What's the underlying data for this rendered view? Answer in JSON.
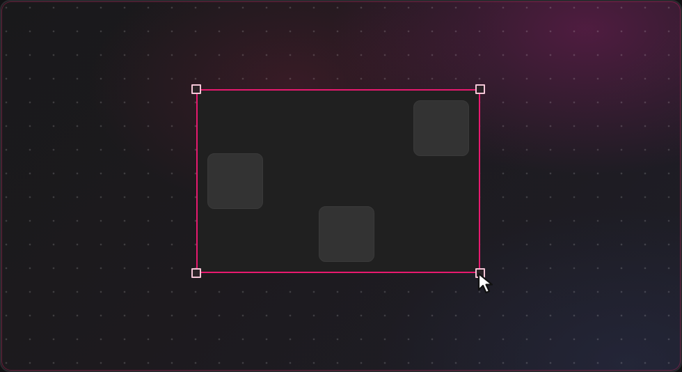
{
  "canvas": {
    "background": "dot-grid-dark",
    "accent_color": "#e8196f"
  },
  "selection": {
    "frame_fill": "#202020",
    "frame_stroke": "#e8196f",
    "handle_fill": "#f5c7d8",
    "handles": [
      "top-left",
      "top-right",
      "bottom-left",
      "bottom-right"
    ],
    "items": [
      {
        "name": "block-left",
        "fill": "#333333"
      },
      {
        "name": "block-middle",
        "fill": "#333333"
      },
      {
        "name": "block-right",
        "fill": "#333333"
      }
    ]
  },
  "cursor": {
    "icon": "pointer-arrow-icon",
    "color": "#ffffff"
  }
}
